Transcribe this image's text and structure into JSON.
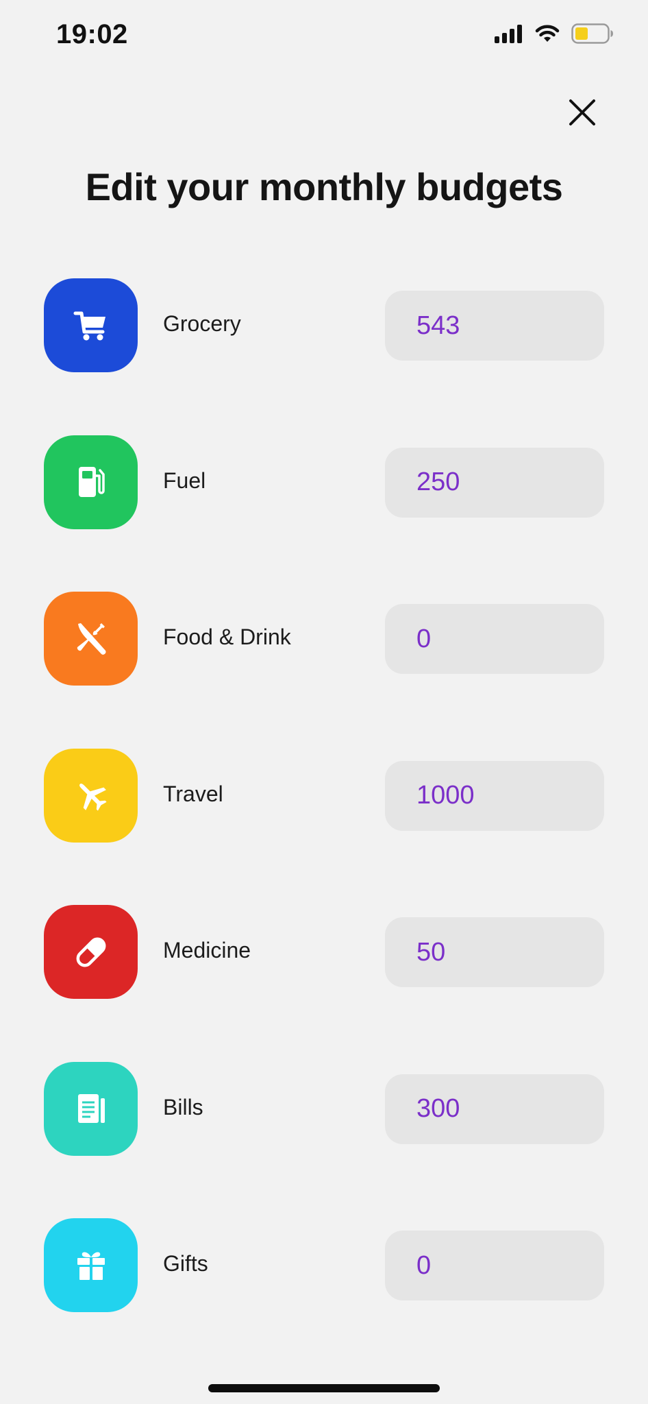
{
  "status_bar": {
    "time": "19:02",
    "battery_color": "#f5cf1c"
  },
  "header": {
    "title": "Edit your monthly budgets",
    "close_icon": "close-icon"
  },
  "budgets": [
    {
      "label": "Grocery",
      "value": "543",
      "icon": "cart-icon",
      "color": "#1c4bd8"
    },
    {
      "label": "Fuel",
      "value": "250",
      "icon": "fuel-pump-icon",
      "color": "#21c55e"
    },
    {
      "label": "Food & Drink",
      "value": "0",
      "icon": "utensils-icon",
      "color": "#f97a1f"
    },
    {
      "label": "Travel",
      "value": "1000",
      "icon": "airplane-icon",
      "color": "#facc17"
    },
    {
      "label": "Medicine",
      "value": "50",
      "icon": "pill-icon",
      "color": "#dc2626"
    },
    {
      "label": "Bills",
      "value": "300",
      "icon": "receipt-icon",
      "color": "#2dd4bf"
    },
    {
      "label": "Gifts",
      "value": "0",
      "icon": "gift-icon",
      "color": "#22d3ee"
    }
  ],
  "value_color": "#7b2fc9"
}
